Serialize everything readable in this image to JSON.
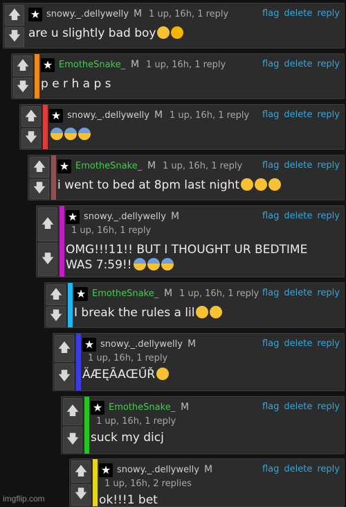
{
  "thread": {
    "comments": [
      {
        "user": "snowy._.dellywelly",
        "user_color": "#d0d0d0",
        "mod": "M",
        "meta": "1 up, 16h, 1 reply",
        "actions": [
          "flag",
          "delete",
          "reply"
        ],
        "body": "are u slightly bad boy",
        "emojis": [
          "hand-over-mouth-emoji",
          "heart-eyes-cat-emoji"
        ],
        "bar_color": null
      },
      {
        "user": "EmotheSnake_",
        "user_color": "#3fcf4a",
        "mod": "M",
        "meta": "1 up, 16h, 1 reply",
        "actions": [
          "flag",
          "delete",
          "reply"
        ],
        "body": "p e r h a p s",
        "emojis": [],
        "bar_color": "#f08a17"
      },
      {
        "user": "snowy._.dellywelly",
        "user_color": "#d0d0d0",
        "mod": "M",
        "meta": "1 up, 16h, 1 reply",
        "actions": [
          "flag",
          "delete",
          "reply"
        ],
        "body": "",
        "emojis": [
          "fearful-face-emoji",
          "fearful-face-emoji",
          "fearful-face-emoji"
        ],
        "bar_color": "#e23b3b"
      },
      {
        "user": "EmotheSnake_",
        "user_color": "#3fcf4a",
        "mod": "M",
        "meta": "1 up, 16h, 1 reply",
        "actions": [
          "flag",
          "delete",
          "reply"
        ],
        "body": "i went to bed at 8pm last night",
        "emojis": [
          "shushing-face-emoji",
          "hand-over-mouth-emoji",
          "hand-over-mouth-emoji"
        ],
        "bar_color": "#8a5252"
      },
      {
        "user": "snowy._.dellywelly",
        "user_color": "#d0d0d0",
        "mod": "M",
        "meta": "1 up, 16h, 1 reply",
        "actions": [
          "flag",
          "delete",
          "reply"
        ],
        "body": "OMG!!!11!! BUT I THOUGHT UR BEDTIME WAS 7:59!!",
        "emojis": [
          "fearful-face-emoji",
          "fearful-face-emoji",
          "fearful-face-emoji"
        ],
        "bar_color": "#c21ec2"
      },
      {
        "user": "EmotheSnake_",
        "user_color": "#3fcf4a",
        "mod": "M",
        "meta": "1 up, 16h, 1 reply",
        "actions": [
          "flag",
          "delete",
          "reply"
        ],
        "body": "I break the rules a lil",
        "emojis": [
          "drooling-face-emoji",
          "winking-face-emoji"
        ],
        "bar_color": "#20b6ee"
      },
      {
        "user": "snowy._.dellywelly",
        "user_color": "#d0d0d0",
        "mod": "M",
        "meta": "1 up, 16h, 1 reply",
        "actions": [
          "flag",
          "delete",
          "reply"
        ],
        "body": "ÄÆĘÃAŒŰŘ",
        "emojis": [
          "weary-face-emoji"
        ],
        "bar_color": "#3b3bea"
      },
      {
        "user": "EmotheSnake_",
        "user_color": "#3fcf4a",
        "mod": "M",
        "meta": "1 up, 16h, 1 reply",
        "actions": [
          "flag",
          "delete",
          "reply"
        ],
        "body": "suck my dicj",
        "emojis": [],
        "bar_color": "#23c423"
      },
      {
        "user": "snowy._.dellywelly",
        "user_color": "#d0d0d0",
        "mod": "M",
        "meta": "1 up, 16h, 2 replies",
        "actions": [
          "flag",
          "delete",
          "reply"
        ],
        "body": "ok!!!1 bet",
        "emojis": [],
        "bar_color": "#e6d51a"
      }
    ]
  },
  "watermark": "imgflip.com"
}
